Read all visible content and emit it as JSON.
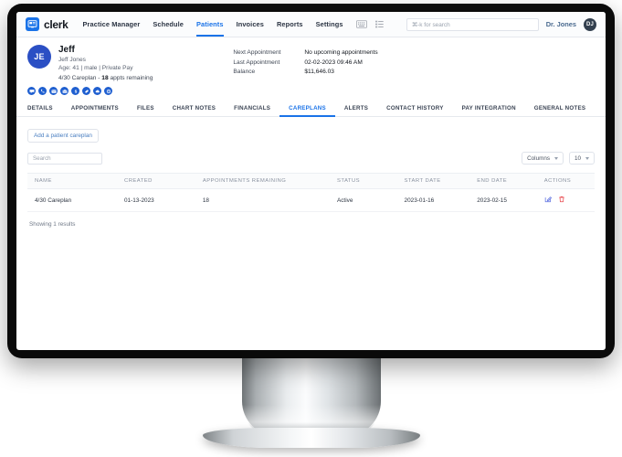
{
  "app": {
    "logo_text": "clerk",
    "logo_icon": "monitor-icon"
  },
  "topnav": {
    "items": [
      {
        "label": "Practice Manager",
        "active": false
      },
      {
        "label": "Schedule",
        "active": false
      },
      {
        "label": "Patients",
        "active": true
      },
      {
        "label": "Invoices",
        "active": false
      },
      {
        "label": "Reports",
        "active": false
      },
      {
        "label": "Settings",
        "active": false
      }
    ],
    "icons": [
      "keyboard-icon",
      "list-icon"
    ],
    "search_placeholder": "⌘-k for search",
    "user_name": "Dr. Jones",
    "user_initials": "DJ"
  },
  "patient": {
    "initials": "JE",
    "name": "Jeff",
    "full_name": "Jeff Jones",
    "demographics": "Age: 41 | male | Private Pay",
    "careplan_prefix": "4/30 Careplan - ",
    "careplan_count": "18",
    "careplan_suffix": " appts remaining",
    "quick_icons": [
      "chat-icon",
      "phone-icon",
      "email-icon",
      "briefcase-icon",
      "dollar-icon",
      "pill-icon",
      "cloud-icon",
      "settings-icon"
    ],
    "details": [
      {
        "label": "Next Appointment",
        "value": "No upcoming appointments"
      },
      {
        "label": "Last Appointment",
        "value": "02-02-2023 09:46 AM"
      },
      {
        "label": "Balance",
        "value": "$11,646.03"
      }
    ]
  },
  "tabs": [
    {
      "label": "DETAILS",
      "active": false
    },
    {
      "label": "APPOINTMENTS",
      "active": false
    },
    {
      "label": "FILES",
      "active": false
    },
    {
      "label": "CHART NOTES",
      "active": false
    },
    {
      "label": "FINANCIALS",
      "active": false
    },
    {
      "label": "CAREPLANS",
      "active": true
    },
    {
      "label": "ALERTS",
      "active": false
    },
    {
      "label": "CONTACT HISTORY",
      "active": false
    },
    {
      "label": "PAY INTEGRATION",
      "active": false
    },
    {
      "label": "GENERAL NOTES",
      "active": false
    }
  ],
  "toolbar": {
    "add_label": "Add a patient careplan",
    "search_placeholder": "Search",
    "columns_label": "Columns",
    "page_size": "10"
  },
  "table": {
    "columns": [
      "NAME",
      "CREATED",
      "APPOINTMENTS REMAINING",
      "STATUS",
      "START DATE",
      "END DATE",
      "ACTIONS"
    ],
    "rows": [
      {
        "name": "4/30 Careplan",
        "created": "01-13-2023",
        "appointments_remaining": "18",
        "status": "Active",
        "start_date": "2023-01-16",
        "end_date": "2023-02-15",
        "actions": [
          "edit-icon",
          "delete-icon"
        ]
      }
    ],
    "footer": "Showing 1 results"
  },
  "colors": {
    "accent": "#1a73e8",
    "avatar": "#2b4fc4",
    "edit": "#5b6fe0",
    "delete": "#e8474c",
    "bezel": "#0a0a0a"
  }
}
